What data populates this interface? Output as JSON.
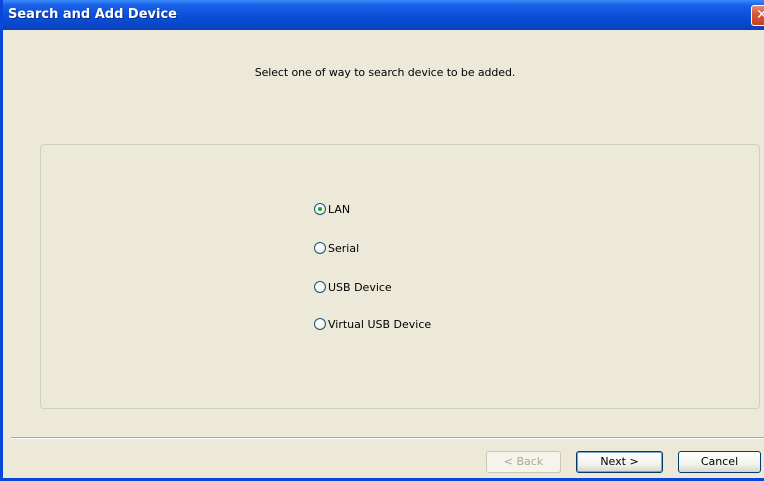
{
  "window": {
    "title": "Search and Add Device",
    "close_label": "✕"
  },
  "instruction": "Select one of  way to search device to be added.",
  "search_options": [
    {
      "label": "LAN",
      "selected": true
    },
    {
      "label": "Serial",
      "selected": false
    },
    {
      "label": "USB Device",
      "selected": false
    },
    {
      "label": "Virtual USB Device",
      "selected": false
    }
  ],
  "buttons": {
    "back": "< Back",
    "next": "Next >",
    "cancel": "Cancel"
  },
  "colors": {
    "titlebar": "#0a4fd8",
    "dialog_background": "#ece9d8",
    "radio_dot": "#21a121"
  }
}
